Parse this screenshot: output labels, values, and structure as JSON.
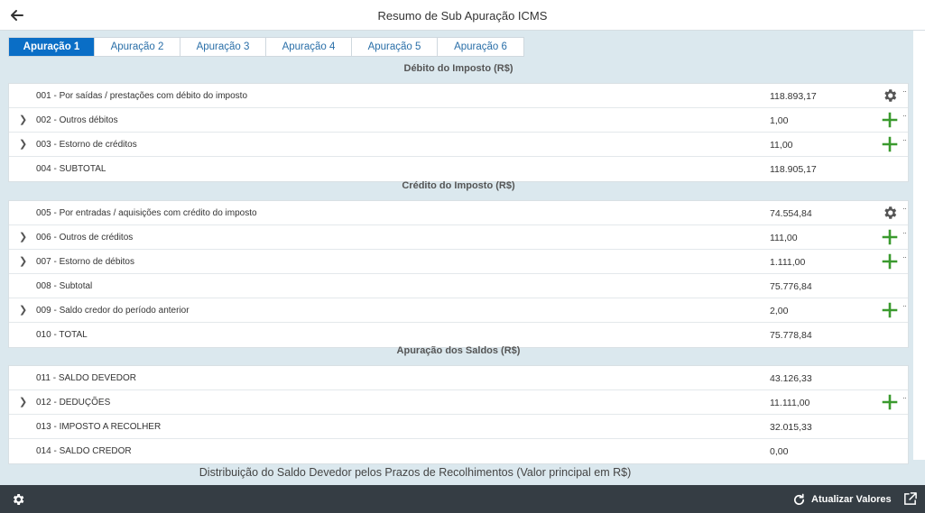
{
  "header": {
    "title": "Resumo de Sub Apuração ICMS",
    "back_icon": "arrow-left-icon"
  },
  "tabs": [
    {
      "label": "Apuração 1",
      "active": true
    },
    {
      "label": "Apuração 2"
    },
    {
      "label": "Apuração 3"
    },
    {
      "label": "Apuração 4"
    },
    {
      "label": "Apuração 5"
    },
    {
      "label": "Apuração 6"
    }
  ],
  "sections": {
    "debito": {
      "title": "Débito do Imposto (R$)",
      "rows": [
        {
          "label": "001 - Por saídas / prestações com débito do imposto",
          "value": "118.893,17",
          "action": "gear-icon"
        },
        {
          "label": "002 - Outros débitos",
          "value": "1,00",
          "action": "plus-icon",
          "expandable": true
        },
        {
          "label": "003 - Estorno de créditos",
          "value": "11,00",
          "action": "plus-icon",
          "expandable": true
        },
        {
          "label": "004 - SUBTOTAL",
          "value": "118.905,17"
        }
      ]
    },
    "credito": {
      "title": "Crédito do Imposto (R$)",
      "rows": [
        {
          "label": "005 - Por entradas / aquisições com crédito do imposto",
          "value": "74.554,84",
          "action": "gear-icon"
        },
        {
          "label": "006 - Outros de créditos",
          "value": "111,00",
          "action": "plus-icon",
          "expandable": true
        },
        {
          "label": "007 - Estorno de débitos",
          "value": "1.111,00",
          "action": "plus-icon",
          "expandable": true
        },
        {
          "label": "008 - Subtotal",
          "value": "75.776,84"
        },
        {
          "label": "009 - Saldo credor do período anterior",
          "value": "2,00",
          "action": "plus-icon",
          "expandable": true
        },
        {
          "label": "010 - TOTAL",
          "value": "75.778,84"
        }
      ]
    },
    "saldos": {
      "title": "Apuração dos Saldos (R$)",
      "rows": [
        {
          "label": "011 - SALDO DEVEDOR",
          "value": "43.126,33"
        },
        {
          "label": "012 - DEDUÇÕES",
          "value": "11.111,00",
          "action": "plus-icon",
          "expandable": true
        },
        {
          "label": "013 - IMPOSTO A RECOLHER",
          "value": "32.015,33"
        },
        {
          "label": "014 - SALDO CREDOR",
          "value": "0,00"
        }
      ]
    }
  },
  "distribution_title": "Distribuição do Saldo Devedor pelos Prazos de Recolhimentos (Valor principal em R$)",
  "footer": {
    "settings_icon": "gear-icon",
    "refresh_label": "Atualizar Valores",
    "refresh_icon": "refresh-icon",
    "share_icon": "share-icon"
  },
  "colors": {
    "active_tab": "#0a6ec6",
    "plus": "#3a9a2e",
    "gear": "#555555",
    "footer_bg": "#353d44",
    "content_bg": "#dbe8ee"
  }
}
